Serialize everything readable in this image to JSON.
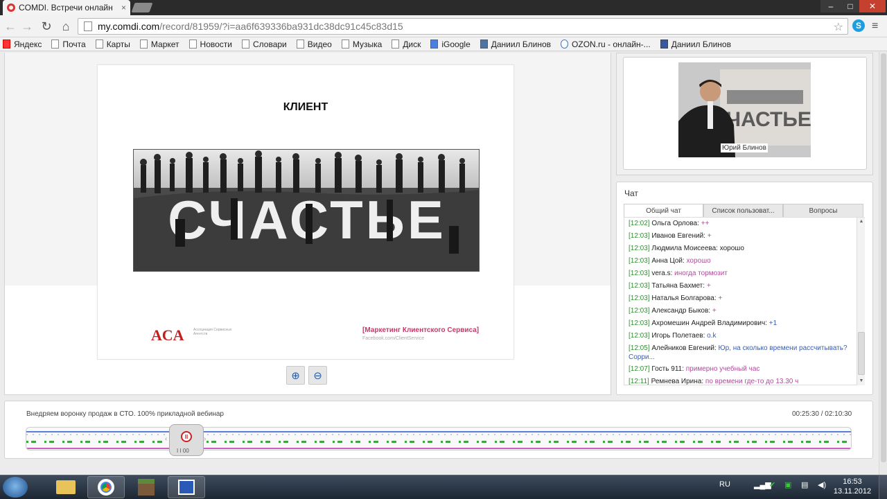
{
  "browser": {
    "tab_title": "COMDI. Встречи онлайн",
    "tab_close": "×",
    "window_controls": {
      "minimize": "–",
      "maximize": "□",
      "close": "✕"
    },
    "nav": {
      "back": "←",
      "forward": "→",
      "reload": "↻",
      "home": "⌂"
    },
    "url_host": "my.comdi.com",
    "url_path": "/record/81959/?i=aa6f639336ba931dc38dc91c45c83d15",
    "star": "☆",
    "skype_icon": "S",
    "menu_icon": "≡",
    "bookmarks": [
      {
        "label": "Яндекс",
        "icon": "y"
      },
      {
        "label": "Почта",
        "icon": "page"
      },
      {
        "label": "Карты",
        "icon": "page"
      },
      {
        "label": "Маркет",
        "icon": "page"
      },
      {
        "label": "Новости",
        "icon": "page"
      },
      {
        "label": "Словари",
        "icon": "page"
      },
      {
        "label": "Видео",
        "icon": "page"
      },
      {
        "label": "Музыка",
        "icon": "page"
      },
      {
        "label": "Диск",
        "icon": "page"
      },
      {
        "label": "iGoogle",
        "icon": "g"
      },
      {
        "label": "Даниил Блинов",
        "icon": "vk"
      },
      {
        "label": "OZON.ru - онлайн-...",
        "icon": "oz"
      },
      {
        "label": "Даниил Блинов",
        "icon": "fb"
      }
    ]
  },
  "slide": {
    "title": "КЛИЕНТ",
    "photo_word": "СЧАСТЬЕ",
    "logo": "АСА",
    "logo_sub": "Ассоциация Сервисных Агентств",
    "tag": "[Маркетинг Клиентского Сервиса]",
    "tag_sub": "Facebook.com/ClientService"
  },
  "zoom": {
    "in": "⊕",
    "out": "⊖"
  },
  "video": {
    "speaker_name": "Юрий Блинов"
  },
  "chat": {
    "title": "Чат",
    "tabs": [
      "Общий чат",
      "Список пользоват...",
      "Вопросы"
    ],
    "messages": [
      {
        "time": "[12:02]",
        "author": "Ольга Орлова:",
        "text": "++",
        "tone": "pink"
      },
      {
        "time": "[12:03]",
        "author": "Иванов Евгений:",
        "text": "+",
        "tone": "pink"
      },
      {
        "time": "[12:03]",
        "author": "Людмила Моисеева:",
        "text": "хорошо",
        "tone": "plain"
      },
      {
        "time": "[12:03]",
        "author": "Анна Цой:",
        "text": "хорошо",
        "tone": "pink"
      },
      {
        "time": "[12:03]",
        "author": "vera.s:",
        "text": "иногда тормозит",
        "tone": "pink"
      },
      {
        "time": "[12:03]",
        "author": "Татьяна Бахмет:",
        "text": "+",
        "tone": "pink"
      },
      {
        "time": "[12:03]",
        "author": "Наталья Болгарова:",
        "text": "+",
        "tone": "pink"
      },
      {
        "time": "[12:03]",
        "author": "Александр Быков:",
        "text": "+",
        "tone": "pink"
      },
      {
        "time": "[12:03]",
        "author": "Ахромешин Андрей Владимирович:",
        "text": "+1",
        "tone": "blue"
      },
      {
        "time": "[12:03]",
        "author": "Игорь Полетаев:",
        "text": "o.k",
        "tone": "blue"
      },
      {
        "time": "[12:05]",
        "author": "Алейников Евгений:",
        "text": "Юр, на сколько времени рассчитывать? Сорри...",
        "tone": "blue"
      },
      {
        "time": "[12:07]",
        "author": "Гость 911:",
        "text": "примерно  учебный час",
        "tone": "pink"
      },
      {
        "time": "[12:11]",
        "author": "Ремнева Ирина:",
        "text": "по времени где-то до 13.30 ч",
        "tone": "pink"
      }
    ]
  },
  "player": {
    "title": "Внедряем воронку продаж в СТО. 100% прикладной вебинар",
    "time": "00:25:30 / 02:10:30",
    "handle_label": "I I  00",
    "progress": 0.196
  },
  "taskbar": {
    "lang": "RU",
    "time": "16:53",
    "date": "13.11.2012"
  }
}
